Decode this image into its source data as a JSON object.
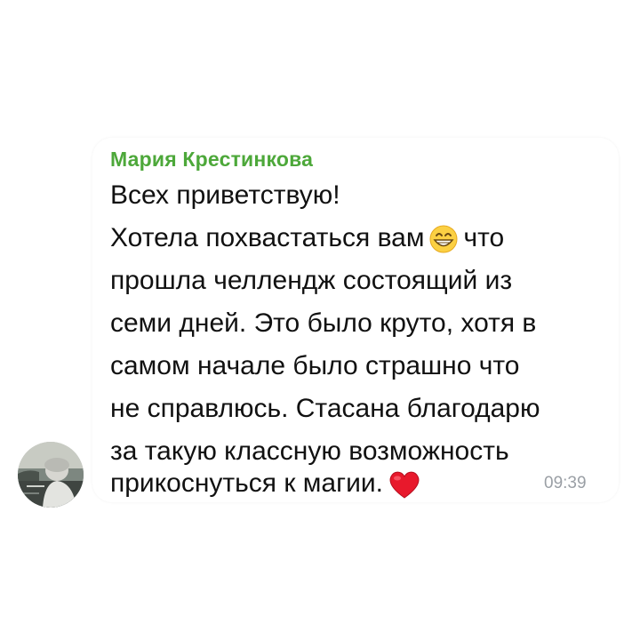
{
  "message": {
    "sender_name": "Мария Крестинкова",
    "sender_color": "#4da83a",
    "lines": [
      "Всех приветствую!",
      "Хотела похвастаться вам",
      "что",
      "прошла челлендж состоящий из",
      "семи дней. Это было круто, хотя в",
      "самом начале было страшно что",
      "не справлюсь. Стасана благодарю",
      "за такую классную возможность",
      "прикоснуться к магии."
    ],
    "emojis": [
      "grinning-face-emoji",
      "red-heart-emoji"
    ],
    "time": "09:39"
  }
}
